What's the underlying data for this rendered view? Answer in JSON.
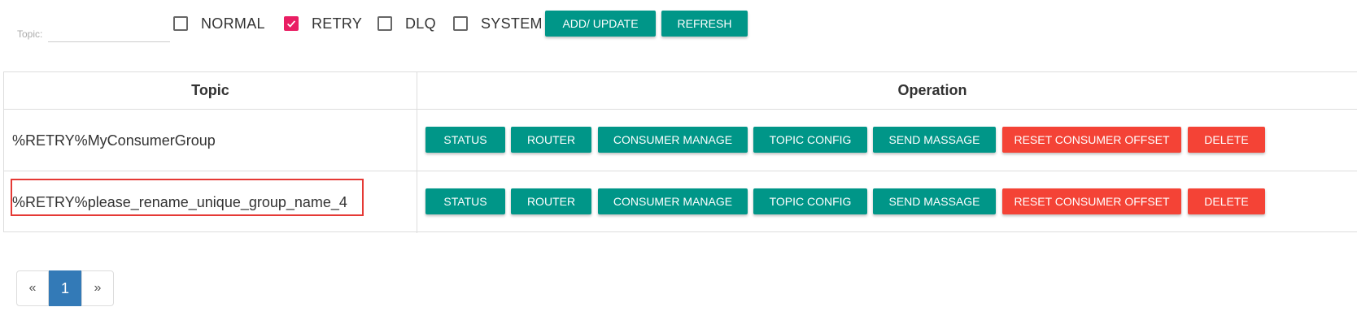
{
  "filter": {
    "topic_label": "Topic:",
    "topic_value": "",
    "checkboxes": [
      {
        "label": "NORMAL",
        "checked": false
      },
      {
        "label": "RETRY",
        "checked": true
      },
      {
        "label": "DLQ",
        "checked": false
      },
      {
        "label": "SYSTEM",
        "checked": false
      }
    ],
    "add_update_label": "ADD/ UPDATE",
    "refresh_label": "REFRESH"
  },
  "table": {
    "headers": {
      "topic": "Topic",
      "operation": "Operation"
    },
    "rows": [
      {
        "topic": "%RETRY%MyConsumerGroup"
      },
      {
        "topic": "%RETRY%please_rename_unique_group_name_4"
      }
    ],
    "actions": {
      "status": "STATUS",
      "router": "ROUTER",
      "consumer_manage": "CONSUMER MANAGE",
      "topic_config": "TOPIC CONFIG",
      "send_massage": "SEND MASSAGE",
      "reset_consumer_offset": "RESET CONSUMER OFFSET",
      "delete": "DELETE"
    }
  },
  "pagination": {
    "prev": "«",
    "current": "1",
    "next": "»"
  },
  "colors": {
    "teal": "#009688",
    "red": "#f44336",
    "pink_check": "#e91e63",
    "page_active": "#337ab7",
    "highlight": "#e53935"
  }
}
